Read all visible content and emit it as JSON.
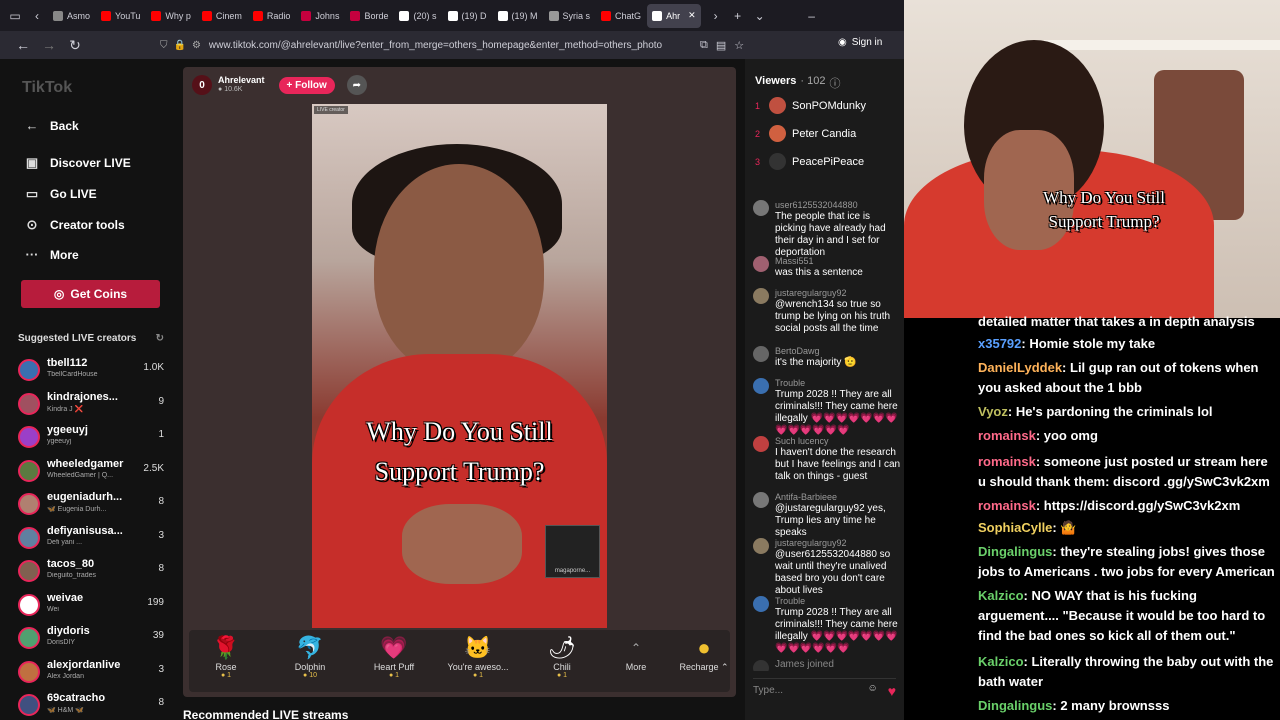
{
  "browser": {
    "tabs": [
      {
        "label": "Asmo",
        "color": "#888"
      },
      {
        "label": "YouTu",
        "color": "#ff0000"
      },
      {
        "label": "Why p",
        "color": "#ff0000"
      },
      {
        "label": "Cinem",
        "color": "#ff0000"
      },
      {
        "label": "Radio",
        "color": "#ff0000"
      },
      {
        "label": "Johns",
        "color": "#c5003e"
      },
      {
        "label": "Borde",
        "color": "#c5003e"
      },
      {
        "label": "(20) s",
        "color": "#fff"
      },
      {
        "label": "(19) D",
        "color": "#fff"
      },
      {
        "label": "(19) M",
        "color": "#fff"
      },
      {
        "label": "Syria s",
        "color": "#999"
      },
      {
        "label": "ChatG",
        "color": "#ff0000"
      },
      {
        "label": "Ahr",
        "color": "#fff"
      }
    ],
    "url": "www.tiktok.com/@ahrelevant/live?enter_from_merge=others_homepage&enter_method=others_photo",
    "signin": "Sign in"
  },
  "sidebar": {
    "logo": "TikTok",
    "back": "Back",
    "nav": [
      "Discover LIVE",
      "Go LIVE",
      "Creator tools",
      "More"
    ],
    "coins": "Get Coins",
    "suggested_title": "Suggested LIVE creators",
    "creators": [
      {
        "name": "tbell112",
        "sub": "TbellCardHouse",
        "count": "1.0K",
        "color": "#3a6fb0"
      },
      {
        "name": "kindrajones...",
        "sub": "Kindra J ❌",
        "count": "9",
        "color": "#a05060"
      },
      {
        "name": "ygeeuyj",
        "sub": "ygeeuyj",
        "count": "1",
        "color": "#9b3fc8"
      },
      {
        "name": "wheeledgamer",
        "sub": "WheeledGamer | Q...",
        "count": "2.5K",
        "color": "#5a7a40"
      },
      {
        "name": "eugeniadurh...",
        "sub": "🦋 Eugenia Durh...",
        "count": "8",
        "color": "#b08070"
      },
      {
        "name": "defiyanisusa...",
        "sub": "Defi yani ...",
        "count": "3",
        "color": "#6080a0"
      },
      {
        "name": "tacos_80",
        "sub": "Dieguito_trades",
        "count": "8",
        "color": "#806050"
      },
      {
        "name": "weivae",
        "sub": "Wei",
        "count": "199",
        "color": "#fff"
      },
      {
        "name": "diydoris",
        "sub": "DorisDIY",
        "count": "39",
        "color": "#50a070"
      },
      {
        "name": "alexjordanlive",
        "sub": "Alex Jordan",
        "count": "3",
        "color": "#c07040"
      },
      {
        "name": "69catracho",
        "sub": "🦋 H&M 🦋",
        "count": "8",
        "color": "#405080"
      }
    ]
  },
  "stream": {
    "streamer": "Ahrelevant",
    "followers": "10.6K",
    "follow": "+ Follow",
    "caption_line1": "Why Do You Still",
    "caption_line2": "Support Trump?",
    "live_tag": "LIVE creator",
    "badge": "magaporne...",
    "gifts": [
      {
        "icon": "🌹",
        "label": "Rose",
        "price": "1"
      },
      {
        "icon": "🐬",
        "label": "Dolphin",
        "price": "10"
      },
      {
        "icon": "💗",
        "label": "Heart Puff",
        "price": "1"
      },
      {
        "icon": "🐱",
        "label": "You're aweso...",
        "price": "1"
      },
      {
        "icon": "🌶",
        "label": "Chili",
        "price": "1"
      }
    ],
    "more": "More",
    "recharge": "Recharge",
    "recommended": "Recommended LIVE streams"
  },
  "viewers": {
    "title": "Viewers",
    "count": "· 102",
    "top": [
      {
        "rank": "1",
        "name": "SonPOMdunky"
      },
      {
        "rank": "2",
        "name": "Peter Candia"
      },
      {
        "rank": "3",
        "name": "PeacePiPeace"
      }
    ],
    "messages": [
      {
        "user": "user6125532044880",
        "text": "The people that ice is picking have already had their day in and I set for deportation"
      },
      {
        "user": "Massi551",
        "text": "was this a sentence"
      },
      {
        "user": "justaregularguy92",
        "text": "@wrench134 so true so trump be lying on his truth social posts all the time"
      },
      {
        "user": "BertoDawg",
        "text": "it's the majority 🫡"
      },
      {
        "user": "Trouble",
        "text": "Trump 2028 !! They are all criminals!!! They came here illegally 💗💗💗💗💗💗💗💗💗💗💗💗💗"
      },
      {
        "user": "Such lucency",
        "text": "I haven't done the research but I have feelings and I can talk on things - guest"
      },
      {
        "user": "Antifa-Barbieee",
        "text": "@justaregularguy92 yes, Trump lies any time he speaks"
      },
      {
        "user": "justaregularguy92",
        "text": "@user6125532044880 so wait until they're unalived based bro you don't care about lives"
      },
      {
        "user": "Trouble",
        "text": "Trump 2028 !! They are all criminals!!! They came here illegally 💗💗💗💗💗💗💗💗💗💗💗💗💗"
      },
      {
        "user": "",
        "text": "James joined"
      }
    ],
    "type_placeholder": "Type..."
  },
  "webcam": {
    "caption_line1": "Why Do You Still",
    "caption_line2": "Support Trump?"
  },
  "chat": [
    {
      "user": "",
      "text": "detailed matter that takes a in depth analysis",
      "color": "#fff"
    },
    {
      "user": "x35792",
      "text": "Homie stole my take",
      "color": "#5aa0ff"
    },
    {
      "user": "DanielLyddek",
      "text": "Lil gup ran out of tokens when you asked about the 1 bbb",
      "color": "#ffb35a"
    },
    {
      "user": "Vyoz",
      "text": "He's pardoning the criminals lol",
      "color": "#c0c060"
    },
    {
      "user": "romainsk",
      "text": "yoo omg",
      "color": "#ff6a8a"
    },
    {
      "user": "romainsk",
      "text": "someone just posted ur stream here u should thank them: discord .gg/ySwC3vk2xm",
      "color": "#ff6a8a"
    },
    {
      "user": "romainsk",
      "text": "https://discord.gg/ySwC3vk2xm",
      "color": "#ff6a8a"
    },
    {
      "user": "SophiaCylle",
      "text": "🤷",
      "color": "#f0d060"
    },
    {
      "user": "Dingalingus",
      "text": "they're stealing jobs! gives those jobs to Americans . two jobs for every American",
      "color": "#6ad06a"
    },
    {
      "user": "Kalzico",
      "text": "NO WAY that is his fucking arguement.... \"Because it would be too hard to find the bad ones so kick all of them out.\"",
      "color": "#6ad06a"
    },
    {
      "user": "Kalzico",
      "text": "Literally throwing the baby out with the bath water",
      "color": "#6ad06a"
    },
    {
      "user": "Dingalingus",
      "text": "2 many brownsss",
      "color": "#6ad06a"
    }
  ]
}
